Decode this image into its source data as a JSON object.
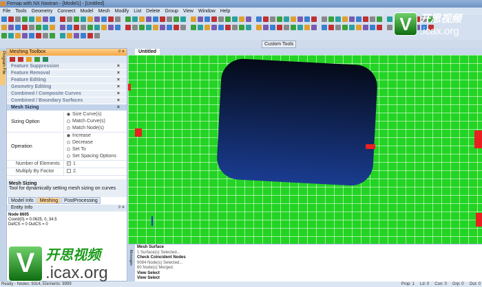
{
  "title": "Femap with NX Nastran - [Model1] - [Untitled]",
  "menu": [
    "File",
    "Tools",
    "Geometry",
    "Connect",
    "Model",
    "Mesh",
    "Modify",
    "List",
    "Delete",
    "Group",
    "View",
    "Window",
    "Help"
  ],
  "custom_tools": "Custom Tools",
  "program_file_tab": "Program File",
  "toolbox": {
    "title": "Meshing Toolbox",
    "sections": [
      "Feature Suppression",
      "Feature Removal",
      "Feature Editing",
      "Geometry Editing",
      "Combined / Composite Curves",
      "Combined / Boundary Surfaces"
    ],
    "active_section": "Mesh Sizing",
    "sizing_option_label": "Sizing Option",
    "sizing_options": [
      "Size Curve(s)",
      "Match Curve(s)",
      "Match Node(s)"
    ],
    "operation_label": "Operation",
    "operations": [
      "Increase",
      "Decrease",
      "Set To",
      "Set Spacing Options"
    ],
    "num_elements_label": "Number of Elements",
    "num_elements_value": "1",
    "multiply_label": "Multiply By Factor",
    "multiply_value": "2.",
    "desc_title": "Mesh Sizing",
    "desc_text": "Tool for dynamically setting mesh sizing on curves"
  },
  "panel_tabs": [
    "Model Info",
    "Meshing",
    "PostProcessing"
  ],
  "entity_info": {
    "title": "Entity Info",
    "node": "Node 8605",
    "coord": "Coord(0) = 0.0625, 0, 34.5",
    "cs": "DefCS = 0  OutCS = 0"
  },
  "view_tab": "Untitled",
  "messages_tab": "Messages",
  "messages": [
    {
      "text": "Mesh Surface",
      "bold": true
    },
    {
      "text": "1 Surface(s) Selected...",
      "bold": false
    },
    {
      "text": "Check Coincident Nodes",
      "bold": true
    },
    {
      "text": "9084 Node(s) Selected...",
      "bold": false
    },
    {
      "text": "60 Node(s) Merged.",
      "bold": false
    },
    {
      "text": "View Select",
      "bold": true
    },
    {
      "text": "View Select",
      "bold": true
    }
  ],
  "status": {
    "left": "Ready - Nodes: 9314, Elements: 8999",
    "prop": "Prop: 1",
    "ld": "Ld: 0",
    "con": "Con: 0",
    "grp": "Grp: 0",
    "out": "Out: 0"
  },
  "watermark": {
    "letter": "V",
    "cn": "开思视频",
    "site": ".icax.org"
  }
}
